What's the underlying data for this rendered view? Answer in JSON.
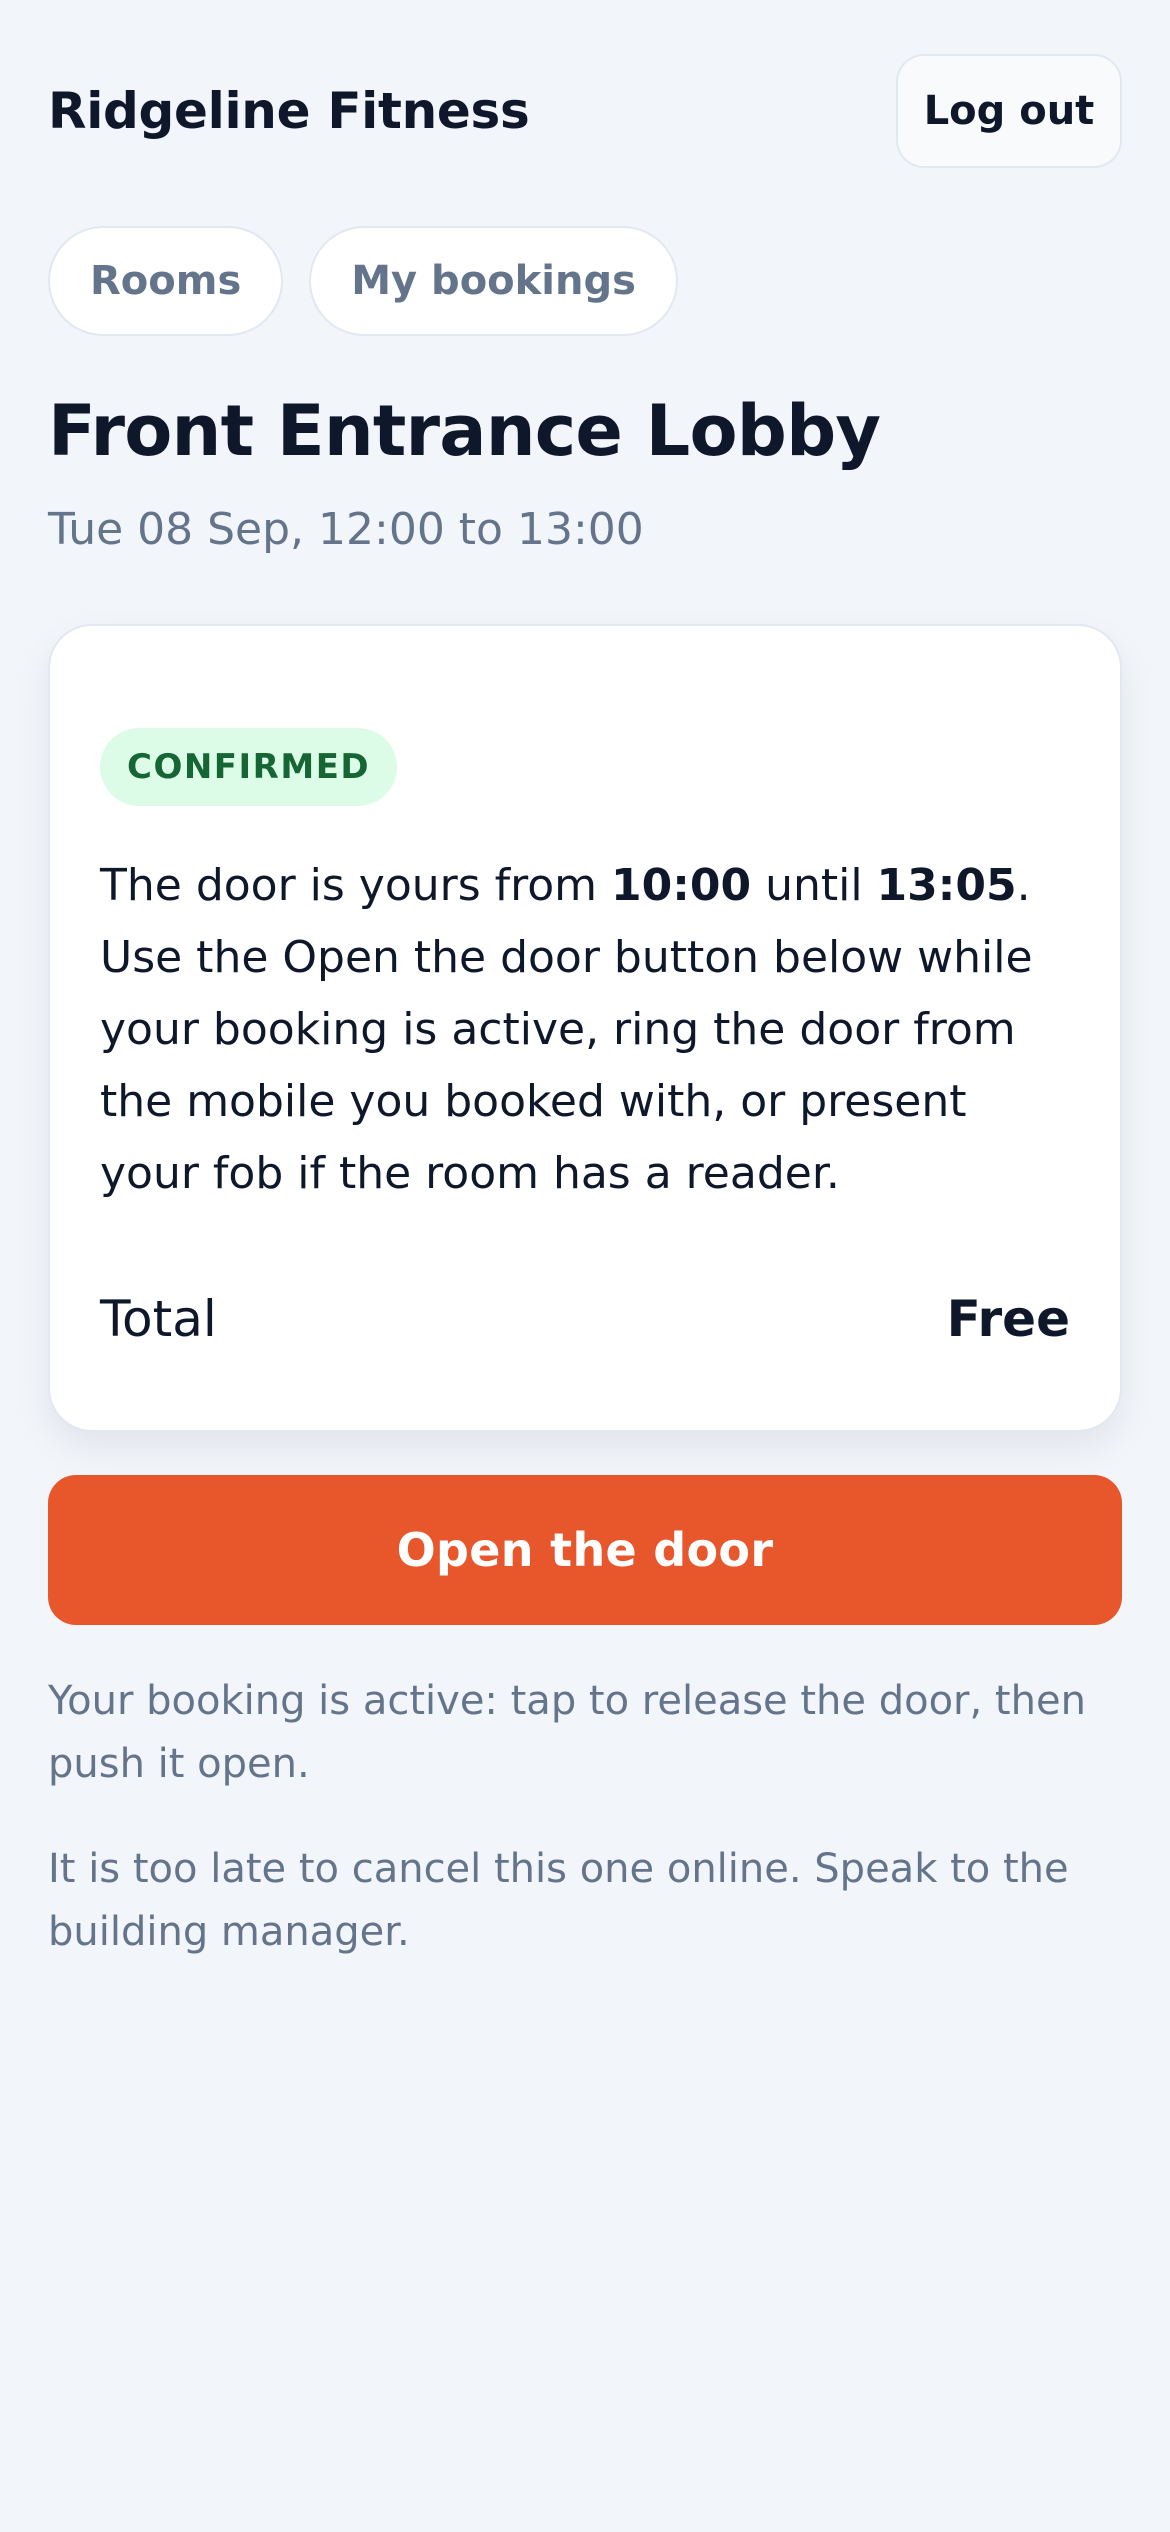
{
  "header": {
    "brand": "Ridgeline Fitness",
    "logout_label": "Log out"
  },
  "tabs": [
    {
      "label": "Rooms"
    },
    {
      "label": "My bookings"
    }
  ],
  "booking": {
    "room_name": "Front Entrance Lobby",
    "datetime": "Tue 08 Sep, 12:00 to 13:00",
    "status": "CONFIRMED",
    "message": {
      "part1": "The door is yours from ",
      "start_time": "10:00",
      "part2": " until ",
      "end_time": "13:05",
      "part3": ". Use the Open the door button below while your booking is active, ring the door from the mobile you booked with, or present your fob if the room has a reader."
    },
    "total_label": "Total",
    "total_value": "Free"
  },
  "actions": {
    "open_door_label": "Open the door"
  },
  "notes": {
    "active": "Your booking is active: tap to release the door, then push it open.",
    "cancel": "It is too late to cancel this one online. Speak to the building manager."
  },
  "colors": {
    "background": "#f2f5fa",
    "accent": "#e8562b",
    "status_bg": "#dcfce7",
    "status_text": "#166534",
    "muted_text": "#64748b"
  }
}
